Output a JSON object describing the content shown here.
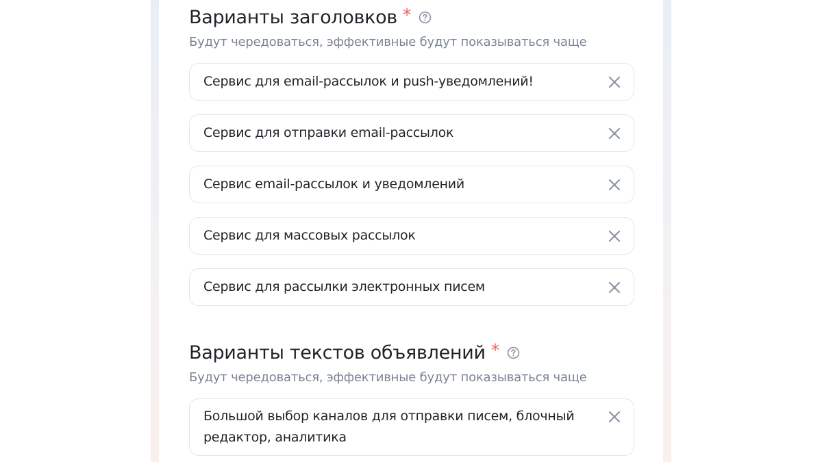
{
  "colors": {
    "text": "#1f2329",
    "muted": "#7a8496",
    "required": "#f0625c",
    "border": "#e3e6ea",
    "icon": "#8e96a4"
  },
  "headlines": {
    "title": "Варианты заголовков",
    "required_mark": "*",
    "help_icon": "question-circle-icon",
    "subtitle": "Будут чередоваться, эффективные будут показываться чаще",
    "items": [
      "Сервис для email-рассылок и push-уведомлений!",
      "Сервис для отправки email-рассылок",
      "Сервис email-рассылок и уведомлений",
      "Сервис для массовых рассылок",
      "Сервис для рассылки электронных писем"
    ],
    "clear_icon": "close-icon"
  },
  "ad_texts": {
    "title": "Варианты текстов объявлений",
    "required_mark": "*",
    "help_icon": "question-circle-icon",
    "subtitle": "Будут чередоваться, эффективные будут показываться чаще",
    "items": [
      "Большой выбор каналов для отправки писем, блочный редактор, аналитика"
    ],
    "clear_icon": "close-icon"
  }
}
